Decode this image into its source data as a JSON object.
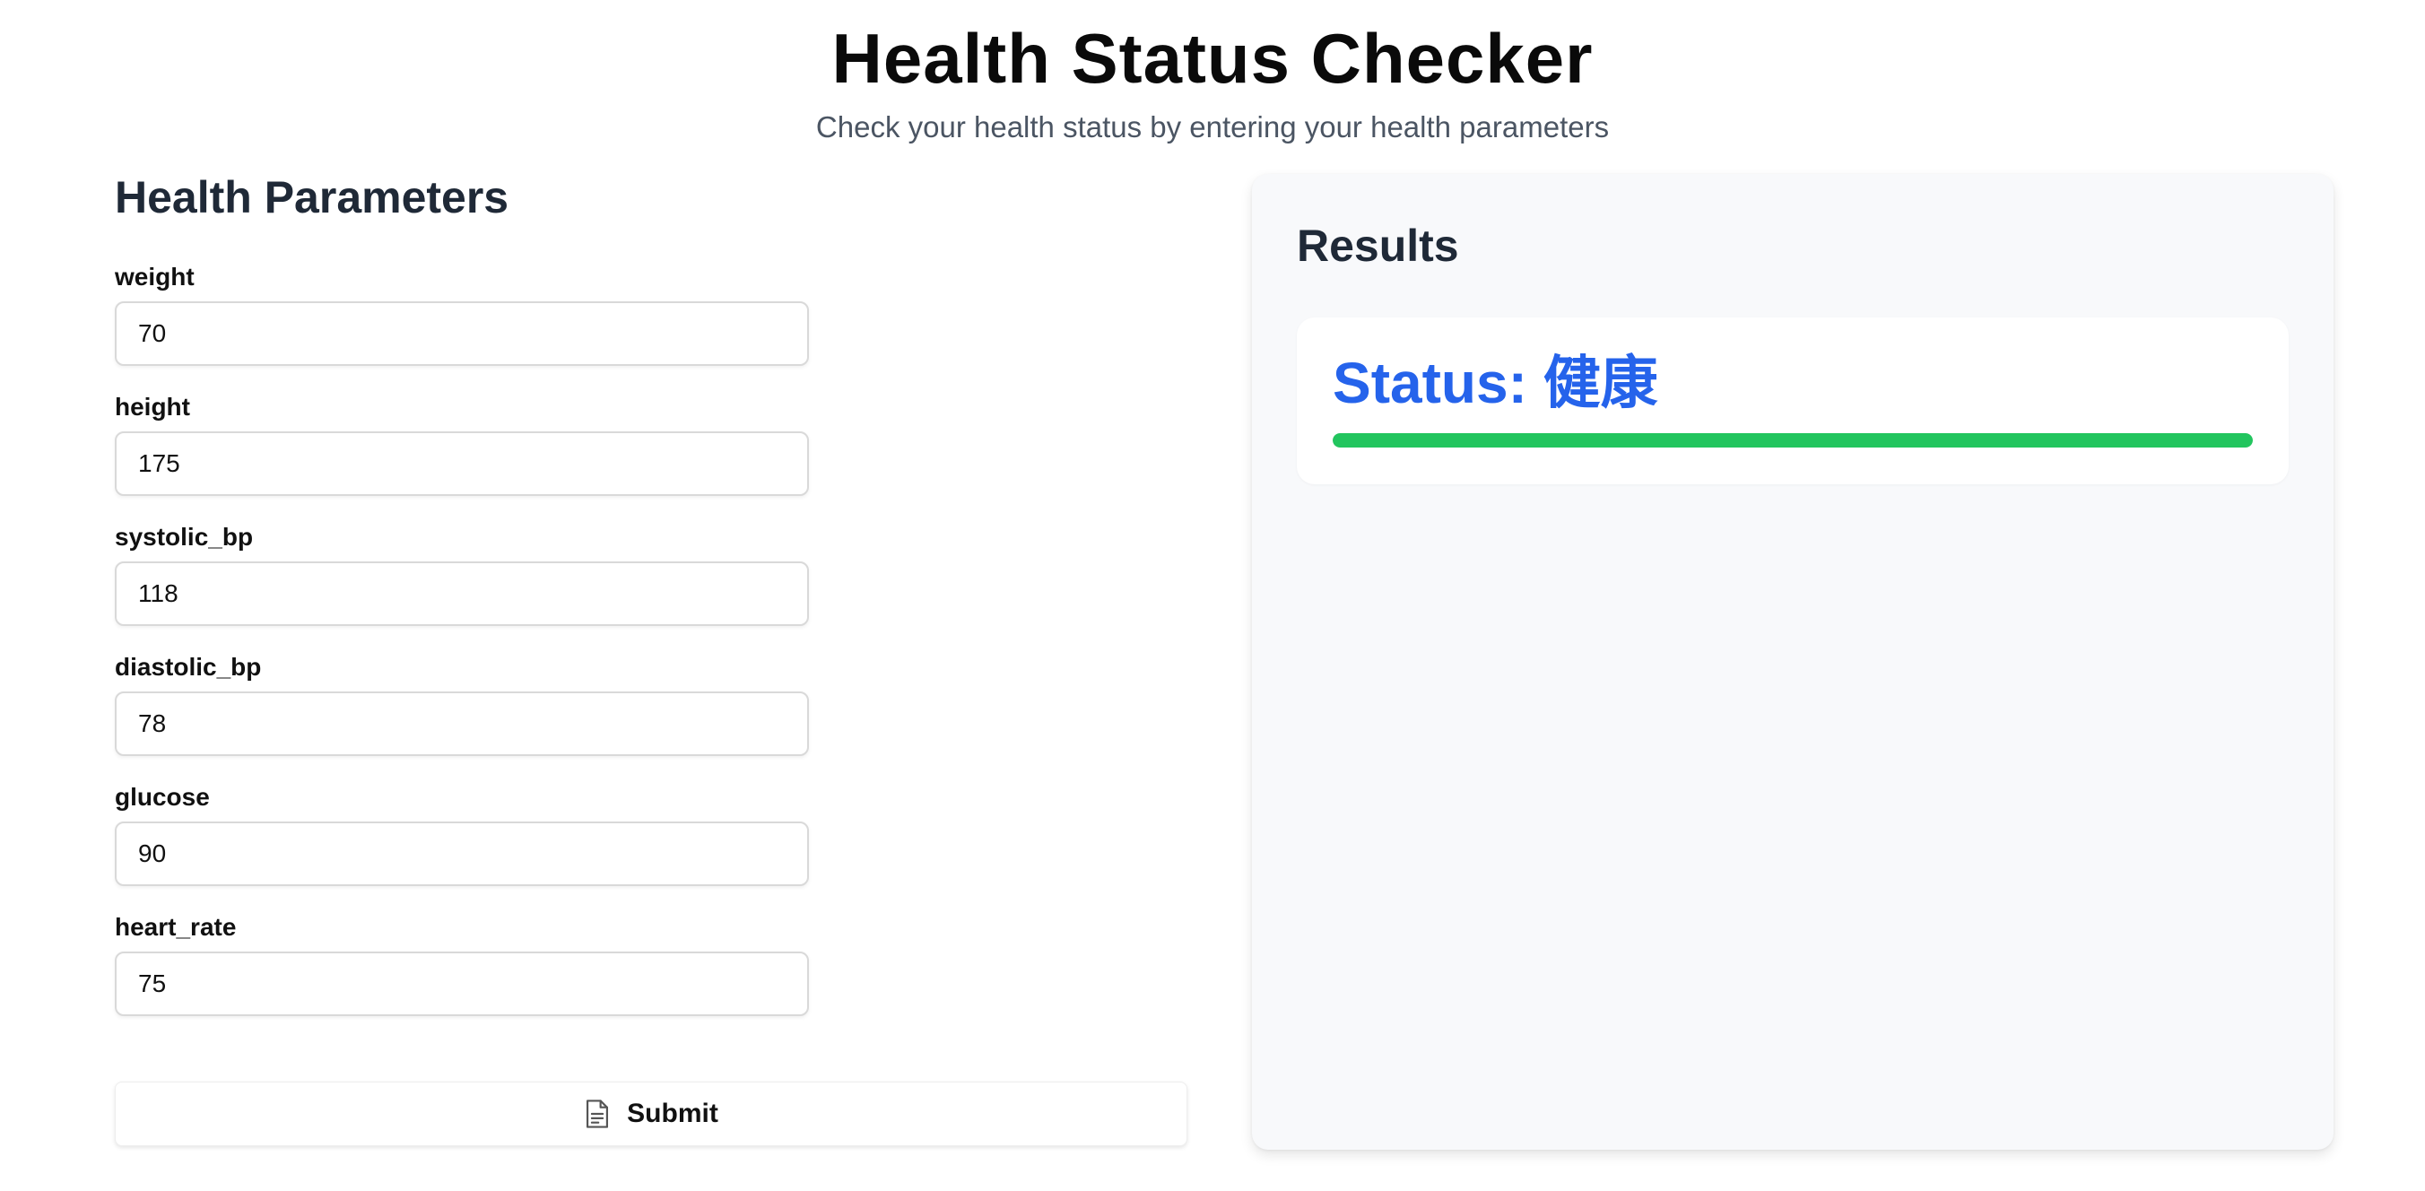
{
  "header": {
    "title": "Health Status Checker",
    "subtitle": "Check your health status by entering your health parameters"
  },
  "form": {
    "title": "Health Parameters",
    "fields": [
      {
        "label": "weight",
        "value": "70"
      },
      {
        "label": "height",
        "value": "175"
      },
      {
        "label": "systolic_bp",
        "value": "118"
      },
      {
        "label": "diastolic_bp",
        "value": "78"
      },
      {
        "label": "glucose",
        "value": "90"
      },
      {
        "label": "heart_rate",
        "value": "75"
      }
    ],
    "submit_label": "Submit",
    "submit_icon": "document-icon"
  },
  "results": {
    "title": "Results",
    "status_prefix": "Status: ",
    "status_value": "健康",
    "progress": 1.0,
    "colors": {
      "status_text": "#2563eb",
      "progress_fill": "#22c55e"
    }
  }
}
